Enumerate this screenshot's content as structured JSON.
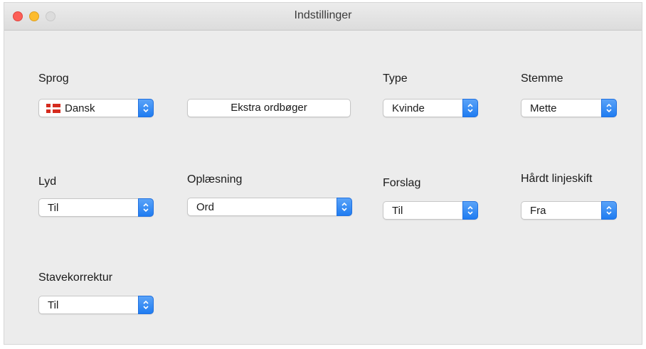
{
  "window": {
    "title": "Indstillinger"
  },
  "labels": {
    "sprog": "Sprog",
    "type": "Type",
    "stemme": "Stemme",
    "lyd": "Lyd",
    "oplaesning": "Oplæsning",
    "forslag": "Forslag",
    "haardt_linjeskift": "Hårdt linjeskift",
    "stavekorrektur": "Stavekorrektur"
  },
  "controls": {
    "sprog_value": "Dansk",
    "sprog_flag_icon": "denmark-flag-icon",
    "ekstra_button": "Ekstra ordbøger",
    "type_value": "Kvinde",
    "stemme_value": "Mette",
    "lyd_value": "Til",
    "oplaesning_value": "Ord",
    "forslag_value": "Til",
    "haardt_value": "Fra",
    "stave_value": "Til"
  },
  "colors": {
    "accent": "#1f7cf1",
    "close": "#fc5f57",
    "minimize": "#fdbc2e",
    "maximize": "#dcdcdc"
  }
}
